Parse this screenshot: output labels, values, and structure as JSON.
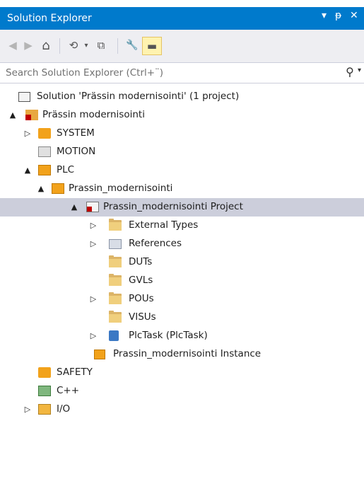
{
  "window": {
    "title": "Solution Explorer",
    "controls": {
      "dropdown": "▾",
      "pin": "ᵽ",
      "close": "✕"
    }
  },
  "toolbar": {
    "buttons": [
      {
        "icon": "back-icon",
        "glyph": "◀",
        "enabled": false
      },
      {
        "icon": "forward-icon",
        "glyph": "▶",
        "enabled": false
      },
      {
        "icon": "home-icon",
        "glyph": "⌂",
        "enabled": true
      },
      {
        "icon": "pending-changes-icon",
        "glyph": "⟲",
        "enabled": true
      },
      {
        "icon": "collapse-all-icon",
        "glyph": "⧉",
        "enabled": true
      },
      {
        "icon": "properties-icon",
        "glyph": "🔧",
        "enabled": true
      },
      {
        "icon": "preview-icon",
        "glyph": "▬",
        "enabled": true,
        "active": true
      }
    ]
  },
  "search": {
    "placeholder": "Search Solution Explorer (Ctrl+¨)",
    "icon": "search-icon"
  },
  "tree": [
    {
      "label": "Solution 'Prässin modernisointi' (1 project)",
      "icon": "solution-icon",
      "expander": "",
      "level": 0
    },
    {
      "label": "Prässin modernisointi",
      "icon": "project-icon",
      "expander": "▲",
      "level": 1
    },
    {
      "label": "SYSTEM",
      "icon": "system-icon",
      "expander": "▷",
      "level": 2
    },
    {
      "label": "MOTION",
      "icon": "motion-icon",
      "expander": "",
      "level": 2
    },
    {
      "label": "PLC",
      "icon": "plc-icon",
      "expander": "▲",
      "level": 2
    },
    {
      "label": "Prassin_modernisointi",
      "icon": "plc-project-icon",
      "expander": "▲",
      "level": 3
    },
    {
      "label": "Prassin_modernisointi Project",
      "icon": "plc-project-file-icon",
      "expander": "▲",
      "level": 4,
      "selected": true
    },
    {
      "label": "External Types",
      "icon": "folder-icon",
      "expander": "▷",
      "level": 5
    },
    {
      "label": "References",
      "icon": "references-icon",
      "expander": "▷",
      "level": 5
    },
    {
      "label": "DUTs",
      "icon": "folder-icon",
      "expander": "",
      "level": 5
    },
    {
      "label": "GVLs",
      "icon": "folder-icon",
      "expander": "",
      "level": 5
    },
    {
      "label": "POUs",
      "icon": "folder-icon",
      "expander": "▷",
      "level": 5
    },
    {
      "label": "VISUs",
      "icon": "folder-icon",
      "expander": "",
      "level": 5
    },
    {
      "label": "PlcTask (PlcTask)",
      "icon": "task-icon",
      "expander": "▷",
      "level": 5
    },
    {
      "label": "Prassin_modernisointi Instance",
      "icon": "plc-instance-icon",
      "expander": "",
      "level": 4
    },
    {
      "label": "SAFETY",
      "icon": "safety-icon",
      "expander": "",
      "level": 2
    },
    {
      "label": "C++",
      "icon": "cpp-icon",
      "expander": "",
      "level": 2
    },
    {
      "label": "I/O",
      "icon": "io-icon",
      "expander": "▷",
      "level": 2
    }
  ],
  "colors": {
    "title_bar": "#007acc",
    "toolbar": "#eeeef2",
    "selection": "#cccedb",
    "folder": "#dcb467"
  }
}
